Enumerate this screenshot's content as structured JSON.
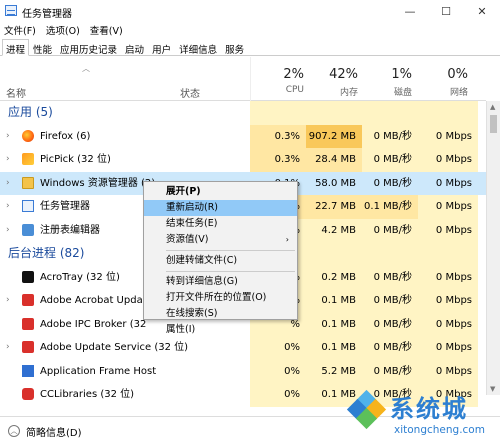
{
  "window": {
    "title": "任务管理器",
    "controls": [
      "—",
      "☐",
      "✕"
    ]
  },
  "menubar": [
    "文件(F)",
    "选项(O)",
    "查看(V)"
  ],
  "tabs": [
    "进程",
    "性能",
    "应用历史记录",
    "启动",
    "用户",
    "详细信息",
    "服务"
  ],
  "header": {
    "name": "名称",
    "status": "状态",
    "cpu": {
      "pct": "2%",
      "label": "CPU"
    },
    "mem": {
      "pct": "42%",
      "label": "内存"
    },
    "disk": {
      "pct": "1%",
      "label": "磁盘"
    },
    "net": {
      "pct": "0%",
      "label": "网络"
    }
  },
  "groups": {
    "apps": "应用 (5)",
    "background": "后台进程 (82)"
  },
  "rows": {
    "firefox": {
      "name": "Firefox (6)",
      "cpu": "0.3%",
      "mem": "907.2 MB",
      "disk": "0 MB/秒",
      "net": "0 Mbps"
    },
    "picpick": {
      "name": "PicPick (32 位)",
      "cpu": "0.3%",
      "mem": "28.4 MB",
      "disk": "0 MB/秒",
      "net": "0 Mbps"
    },
    "explorer": {
      "name": "Windows 资源管理器 (2)",
      "cpu": "0.1%",
      "mem": "58.0 MB",
      "disk": "0 MB/秒",
      "net": "0 Mbps"
    },
    "taskmgr": {
      "name": "任务管理器",
      "cpu": "%",
      "mem": "22.7 MB",
      "disk": "0.1 MB/秒",
      "net": "0 Mbps"
    },
    "regedit": {
      "name": "注册表编辑器",
      "cpu": "%",
      "mem": "4.2 MB",
      "disk": "0 MB/秒",
      "net": "0 Mbps"
    },
    "acrotray": {
      "name": "AcroTray (32 位)",
      "cpu": "%",
      "mem": "0.2 MB",
      "disk": "0 MB/秒",
      "net": "0 Mbps"
    },
    "acrobat": {
      "name": "Adobe Acrobat Update",
      "cpu": "%",
      "mem": "0.1 MB",
      "disk": "0 MB/秒",
      "net": "0 Mbps"
    },
    "adobeipc": {
      "name": "Adobe IPC Broker (32",
      "cpu": "%",
      "mem": "0.1 MB",
      "disk": "0 MB/秒",
      "net": "0 Mbps"
    },
    "adobeupd": {
      "name": "Adobe Update Service (32 位)",
      "cpu": "0%",
      "mem": "0.1 MB",
      "disk": "0 MB/秒",
      "net": "0 Mbps"
    },
    "framehost": {
      "name": "Application Frame Host",
      "cpu": "0%",
      "mem": "5.2 MB",
      "disk": "0 MB/秒",
      "net": "0 Mbps"
    },
    "cclib": {
      "name": "CCLibraries (32 位)",
      "cpu": "0%",
      "mem": "0.1 MB",
      "disk": "0 MB/秒",
      "net": "0 Mbps"
    }
  },
  "context_menu": {
    "expand": "展开(P)",
    "restart": "重新启动(R)",
    "end_task": "结束任务(E)",
    "resource_values": "资源值(V)",
    "create_dump": "创建转储文件(C)",
    "goto_details": "转到详细信息(G)",
    "open_location": "打开文件所在的位置(O)",
    "search_online": "在线搜索(S)",
    "properties": "属性(I)"
  },
  "footer": {
    "less_details": "简略信息(D)"
  },
  "watermark": {
    "brand": "系统城",
    "url": "xitongcheng.com"
  },
  "colors": {
    "accent": "#1a4a9c",
    "selected": "#cde8fb",
    "menu_highlight": "#91c9f7",
    "mem_hot": "#f9c85a"
  }
}
